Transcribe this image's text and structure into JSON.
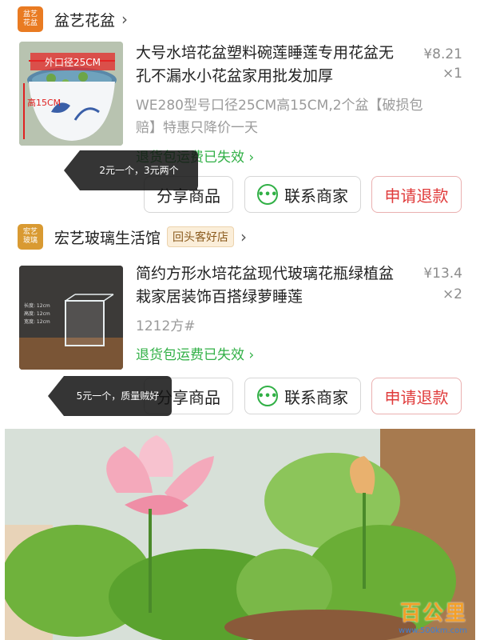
{
  "orders": [
    {
      "shop": {
        "logo_text": [
          "盆艺",
          "花盆"
        ],
        "name": "盆艺花盆",
        "badge": ""
      },
      "product": {
        "title": "大号水培花盆塑料碗莲睡莲专用花盆无孔不漏水小花盆家用批发加厚",
        "price": "¥8.21",
        "quantity": "×1",
        "spec": "WE280型号口径25CM高15CM,2个盆【破损包赔】特惠只降价一天",
        "thumb_labels": {
          "top": "外口径25CM",
          "side": "高15CM"
        }
      },
      "policy": "退货包运费已失效",
      "buttons": {
        "share": "分享商品",
        "contact": "联系商家",
        "refund": "申请退款"
      },
      "tooltip": "2元一个，3元两个"
    },
    {
      "shop": {
        "logo_text": [
          "宏艺",
          "玻璃"
        ],
        "name": "宏艺玻璃生活馆",
        "badge": "回头客好店"
      },
      "product": {
        "title": "简约方形水培花盆现代玻璃花瓶绿植盆栽家居装饰百搭绿萝睡莲",
        "price": "¥13.4",
        "quantity": "×2",
        "spec": "1212方#",
        "thumb_labels": {
          "lines": [
            "长度: 12cm",
            "高度: 12cm",
            "宽度: 12cm"
          ]
        }
      },
      "policy": "退货包运费已失效",
      "buttons": {
        "share": "分享商品",
        "contact": "联系商家",
        "refund": "申请退款"
      },
      "tooltip": "5元一个，质量贼好"
    }
  ],
  "watermark": {
    "text": "百公里",
    "url": "www.500km.com"
  },
  "colors": {
    "green": "#31b046",
    "red": "#e03b3b",
    "orange": "#e97b22"
  }
}
